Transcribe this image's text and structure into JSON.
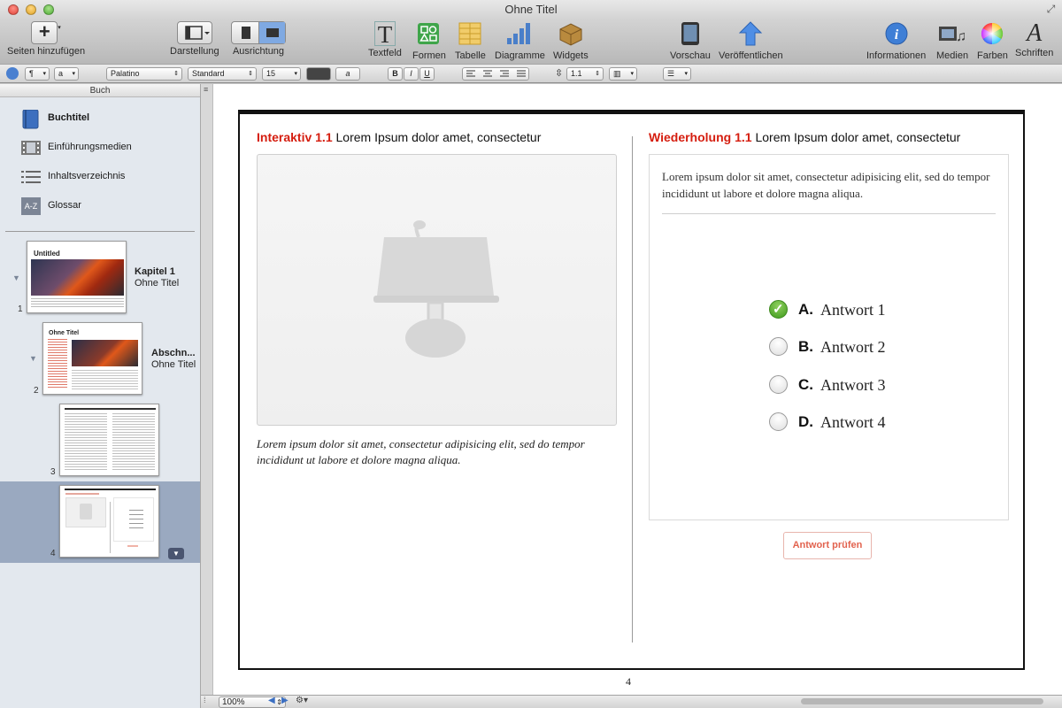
{
  "window": {
    "title": "Ohne Titel"
  },
  "toolbar": {
    "add_pages": "Seiten hinzufügen",
    "view": "Darstellung",
    "orientation": "Ausrichtung",
    "textbox": "Textfeld",
    "shapes": "Formen",
    "table": "Tabelle",
    "charts": "Diagramme",
    "widgets": "Widgets",
    "preview": "Vorschau",
    "publish": "Veröffentlichen",
    "info": "Informationen",
    "media": "Medien",
    "colors": "Farben",
    "fonts": "Schriften"
  },
  "format_bar": {
    "paragraph_style": "¶",
    "char_style": "a",
    "font_family": "Palatino",
    "font_typeface": "Standard",
    "font_size": "15",
    "text_bg": "a",
    "bold": "B",
    "italic": "I",
    "underline": "U",
    "line_spacing": "1.1"
  },
  "sidebar": {
    "header": "Buch",
    "items": [
      {
        "label": "Buchtitel"
      },
      {
        "label": "Einführungsmedien"
      },
      {
        "label": "Inhaltsverzeichnis"
      },
      {
        "label": "Glossar"
      }
    ],
    "glossary_icon_text": "A-Z",
    "pages": [
      {
        "num": "1",
        "thumb_title": "Untitled",
        "label_title": "Kapitel 1",
        "label_sub": "Ohne Titel"
      },
      {
        "num": "2",
        "thumb_title": "Ohne Titel",
        "label_title": "Abschn...",
        "label_sub": "Ohne Titel"
      },
      {
        "num": "3"
      },
      {
        "num": "4"
      }
    ]
  },
  "page": {
    "left_heading_label": "Interaktiv 1.1",
    "left_heading_text": "Lorem Ipsum dolor amet, consectetur",
    "caption": "Lorem ipsum dolor sit amet, consectetur adipisicing elit, sed do tempor incididunt ut labore et dolore magna aliqua.",
    "right_heading_label": "Wiederholung 1.1",
    "right_heading_text": "Lorem Ipsum dolor amet, consectetur",
    "question": "Lorem ipsum dolor sit amet, consectetur adipisicing elit, sed do tempor incididunt ut labore et dolore magna aliqua.",
    "answers": [
      {
        "letter": "A.",
        "text": "Antwort 1",
        "selected": true
      },
      {
        "letter": "B.",
        "text": "Antwort 2",
        "selected": false
      },
      {
        "letter": "C.",
        "text": "Antwort 3",
        "selected": false
      },
      {
        "letter": "D.",
        "text": "Antwort 4",
        "selected": false
      }
    ],
    "check_button": "Antwort prüfen",
    "page_number": "4"
  },
  "statusbar": {
    "zoom": "100%"
  },
  "colors": {
    "accent_red": "#d51d0f",
    "selected_green": "#3f9a1d",
    "sidebar_selection": "#9aa9c0"
  }
}
